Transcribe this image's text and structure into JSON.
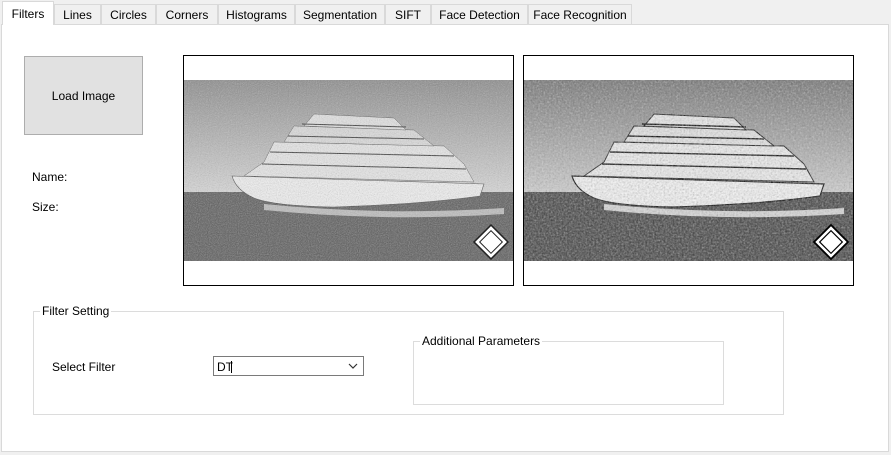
{
  "tabs": [
    {
      "label": "Filters",
      "active": true
    },
    {
      "label": "Lines"
    },
    {
      "label": "Circles"
    },
    {
      "label": "Corners"
    },
    {
      "label": "Histograms"
    },
    {
      "label": "Segmentation"
    },
    {
      "label": "SIFT"
    },
    {
      "label": "Face Detection"
    },
    {
      "label": "Face Recognition"
    }
  ],
  "controls": {
    "load_button_label": "Load Image",
    "name_label": "Name:",
    "size_label": "Size:"
  },
  "images": {
    "original": "noisy cruise ship photo (grayscale)",
    "filtered": "edge-enhanced cruise ship photo (grayscale)"
  },
  "filter_setting": {
    "group_title": "Filter Setting",
    "select_label": "Select Filter",
    "selected_filter": "DT",
    "additional_params_title": "Additional Parameters"
  },
  "icons": [
    "chevron-down-icon"
  ],
  "colors": {
    "panel": "#ffffff",
    "window": "#f0f0f0",
    "button": "#e1e1e1",
    "border": "#adadad"
  }
}
